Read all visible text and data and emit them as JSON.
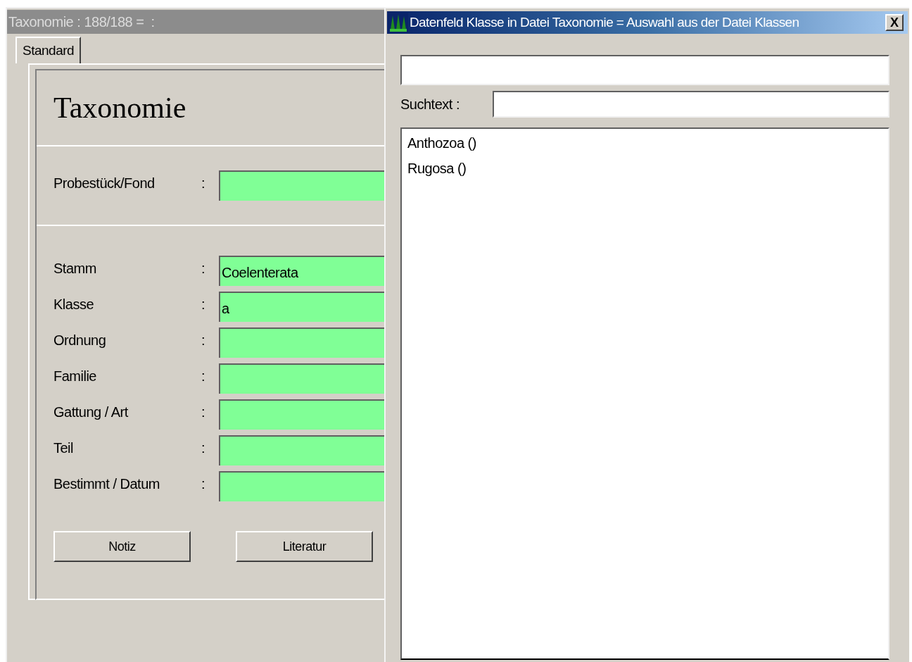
{
  "main_window": {
    "title": "Taxonomie : 188/188 =  :",
    "tabs": [
      {
        "label": "Standard",
        "selected": true
      }
    ],
    "form_title": "Taxonomie",
    "sections": [
      {
        "fields": [
          {
            "label": "Probestück/Fond",
            "colon": ":"
          }
        ]
      },
      {
        "fields": [
          {
            "label": "Stamm",
            "colon": ":",
            "value": "Coelenterata"
          },
          {
            "label": "Klasse",
            "colon": ":",
            "value": "a"
          },
          {
            "label": "Ordnung",
            "colon": ":"
          },
          {
            "label": "Familie",
            "colon": ":"
          },
          {
            "label": "Gattung / Art",
            "colon": ":"
          },
          {
            "label": "Teil",
            "colon": ":"
          },
          {
            "label": "Bestimmt / Datum",
            "colon": ":"
          }
        ]
      }
    ],
    "buttons": [
      "Notiz",
      "Literatur"
    ]
  },
  "dialog": {
    "title": "Datenfeld Klasse in Datei Taxonomie = Auswahl aus der Datei Klassen",
    "close": "X",
    "search_label": "Suchtext :",
    "list_items": [
      "Anthozoa ()",
      "Rugosa ()"
    ]
  }
}
